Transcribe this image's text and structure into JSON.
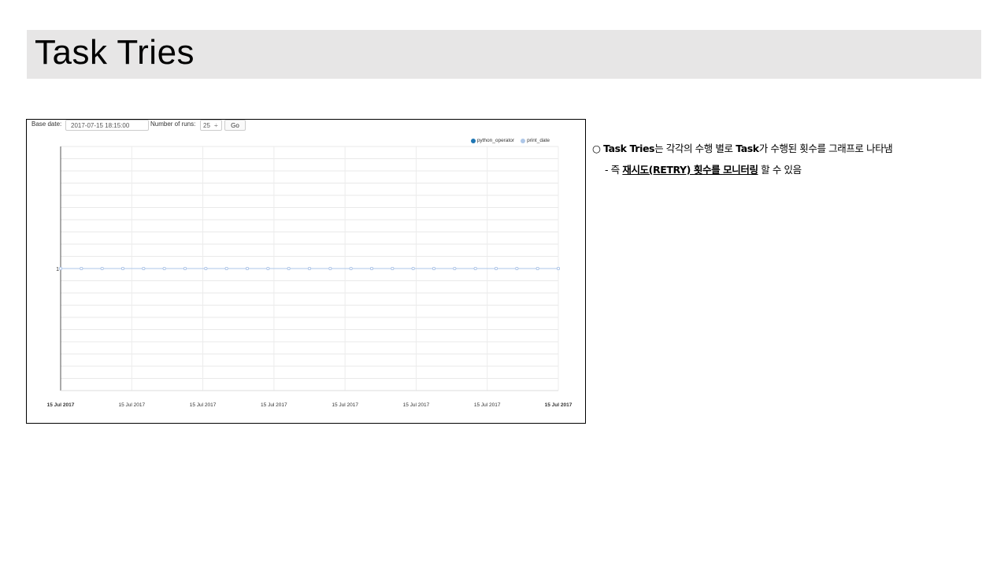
{
  "slide": {
    "title": "Task Tries",
    "description": {
      "bullet": "○",
      "line1_bold": "Task Tries",
      "line1_mid": "는 각각의 수행 별로 ",
      "line1_bold2": "Task",
      "line1_rest": "가 수행된 횟수를 그래프로 나타냄",
      "line2_prefix": "- 즉 ",
      "line2_underline": "재시도(RETRY) 횟수를 모니터링",
      "line2_rest": " 할 수 있음"
    }
  },
  "controls": {
    "base_date_label": "Base date:",
    "base_date_value": "2017-07-15 18:15:00",
    "num_runs_label": "Number of runs:",
    "num_runs_value": "25",
    "num_runs_arrow": "÷",
    "go_label": "Go"
  },
  "legend": [
    {
      "name": "python_operator",
      "color": "#1f77b4"
    },
    {
      "name": "print_date",
      "color": "#aec7e8"
    }
  ],
  "chart_data": {
    "type": "line",
    "x_tick_labels": [
      "15 Jul 2017",
      "15 Jul 2017",
      "15 Jul 2017",
      "15 Jul 2017",
      "15 Jul 2017",
      "15 Jul 2017",
      "15 Jul 2017",
      "15 Jul 2017"
    ],
    "y_tick_labels": [
      "1"
    ],
    "ylim": [
      0,
      2
    ],
    "grid": true,
    "legend_position": "top-right",
    "series": [
      {
        "name": "python_operator",
        "color": "#1f77b4",
        "values": [
          1,
          1,
          1,
          1,
          1,
          1,
          1,
          1,
          1,
          1,
          1,
          1,
          1,
          1,
          1,
          1,
          1,
          1,
          1,
          1,
          1,
          1,
          1,
          1,
          1
        ]
      },
      {
        "name": "print_date",
        "color": "#aec7e8",
        "values": [
          1,
          1,
          1,
          1,
          1,
          1,
          1,
          1,
          1,
          1,
          1,
          1,
          1,
          1,
          1,
          1,
          1,
          1,
          1,
          1,
          1,
          1,
          1,
          1,
          1
        ]
      }
    ]
  }
}
